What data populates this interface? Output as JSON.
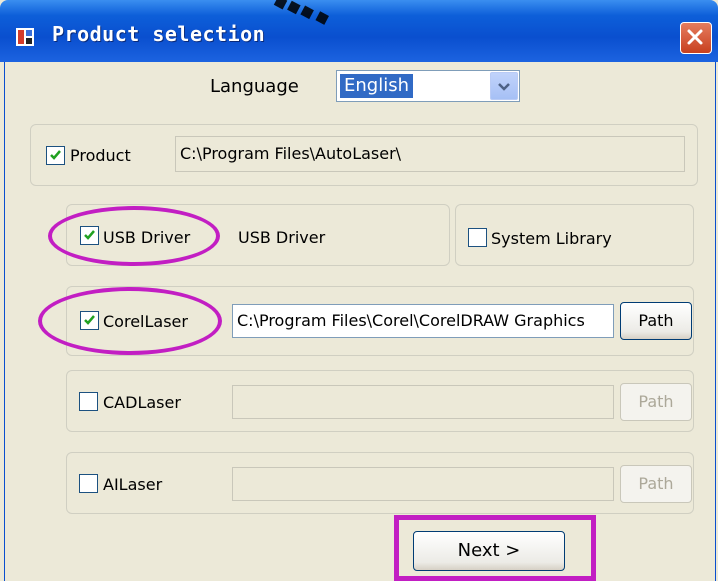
{
  "window": {
    "title": "Product selection"
  },
  "language": {
    "label": "Language",
    "selected": "English"
  },
  "product": {
    "label": "Product",
    "checked": true,
    "path": "C:\\Program Files\\AutoLaser\\"
  },
  "usb_driver": {
    "label": "USB Driver",
    "checked": true,
    "description": "USB Driver"
  },
  "system_library": {
    "label": "System Library",
    "checked": false
  },
  "corellaser": {
    "label": "CorelLaser",
    "checked": true,
    "path": "C:\\Program Files\\Corel\\CorelDRAW Graphics",
    "path_button": "Path"
  },
  "cadlaser": {
    "label": "CADLaser",
    "checked": false,
    "path": "",
    "path_button": "Path"
  },
  "ailaser": {
    "label": "AILaser",
    "checked": false,
    "path": "",
    "path_button": "Path"
  },
  "footer": {
    "next_label": "Next >"
  },
  "colors": {
    "titlebar": "#0a4fcf",
    "highlight": "#c21ec3",
    "window_bg": "#ece9d8"
  },
  "icons": [
    "app-icon",
    "close-icon",
    "chevron-down-icon",
    "checkmark-icon"
  ]
}
